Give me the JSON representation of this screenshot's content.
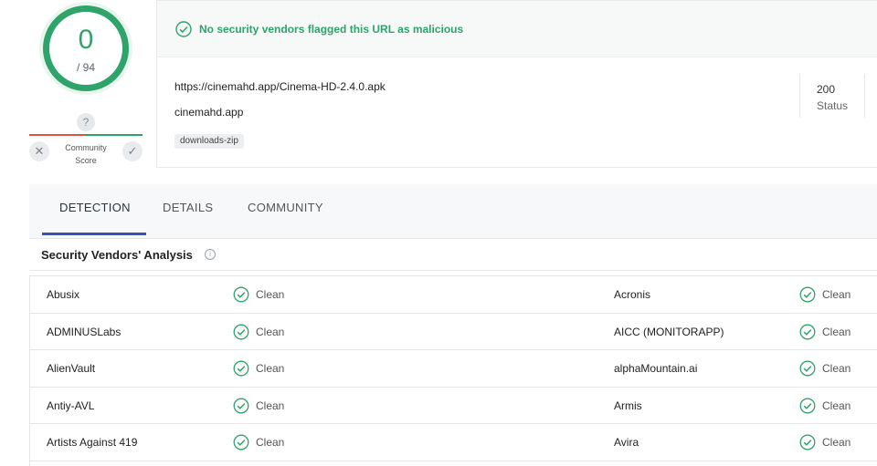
{
  "score": {
    "value": "0",
    "total": "/ 94"
  },
  "community": {
    "unknown_glyph": "?",
    "label_line1": "Community",
    "label_line2": "Score",
    "down_glyph": "✕",
    "up_glyph": "✓"
  },
  "banner": {
    "text": "No security vendors flagged this URL as malicious",
    "color": "#2ea46a"
  },
  "url": {
    "full": "https://cinemahd.app/Cinema-HD-2.4.0.apk",
    "domain": "cinemahd.app",
    "tag": "downloads-zip",
    "status_value": "200",
    "status_label": "Status"
  },
  "tabs": [
    {
      "label": "DETECTION",
      "active": true
    },
    {
      "label": "DETAILS",
      "active": false
    },
    {
      "label": "COMMUNITY",
      "active": false
    }
  ],
  "section": {
    "title": "Security Vendors' Analysis",
    "info_glyph": "i"
  },
  "vendors": [
    {
      "left_name": "Abusix",
      "left_result": "Clean",
      "right_name": "Acronis",
      "right_result": "Clean"
    },
    {
      "left_name": "ADMINUSLabs",
      "left_result": "Clean",
      "right_name": "AICC (MONITORAPP)",
      "right_result": "Clean"
    },
    {
      "left_name": "AlienVault",
      "left_result": "Clean",
      "right_name": "alphaMountain.ai",
      "right_result": "Clean"
    },
    {
      "left_name": "Antiy-AVL",
      "left_result": "Clean",
      "right_name": "Armis",
      "right_result": "Clean"
    },
    {
      "left_name": "Artists Against 419",
      "left_result": "Clean",
      "right_name": "Avira",
      "right_result": "Clean"
    }
  ],
  "icons": {
    "result": "check-circle-icon",
    "banner": "check-circle-icon",
    "info": "info-icon",
    "unknown": "question-icon"
  },
  "colors": {
    "clean": "#2ea46a",
    "accent_tab": "#3b4fb8",
    "community_bad": "#d9534f"
  }
}
